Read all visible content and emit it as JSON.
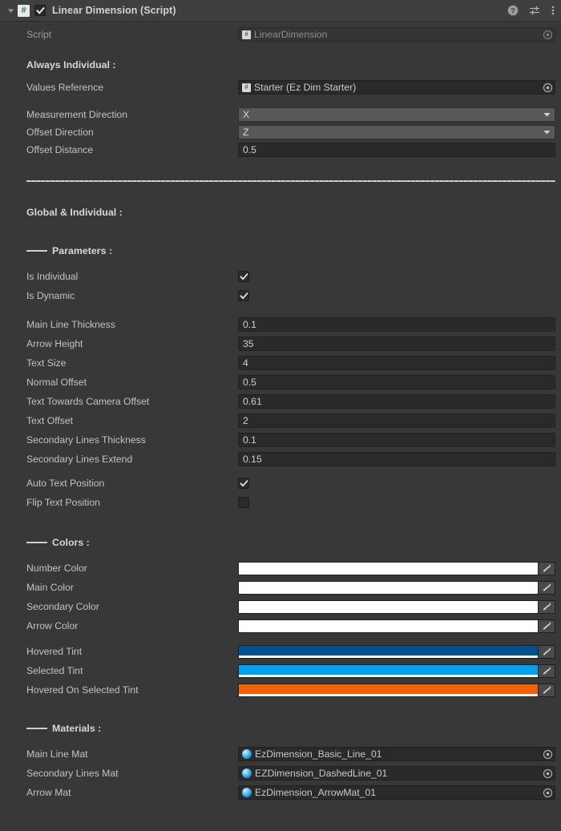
{
  "header": {
    "title": "Linear Dimension (Script)",
    "enabled_checkbox": true,
    "foldout_expanded": true,
    "script_glyph": "#",
    "icons": {
      "foldout": "triangle-down-icon",
      "script": "csharp-script-icon",
      "enabled": "enabled-checkbox",
      "help": "help-icon",
      "preset": "preset-settings-icon",
      "menu": "more-vertical-icon"
    }
  },
  "script_row": {
    "label": "Script",
    "value": "LinearDimension"
  },
  "sections": {
    "always_individual": "Always Individual :",
    "global_individual": "Global & Individual :",
    "parameters": "Parameters :",
    "colors": "Colors :",
    "materials": "Materials :"
  },
  "always_individual": {
    "values_reference": {
      "label": "Values Reference",
      "value": "Starter (Ez Dim Starter)"
    },
    "measurement_direction": {
      "label": "Measurement Direction",
      "value": "X"
    },
    "offset_direction": {
      "label": "Offset Direction",
      "value": "Z"
    },
    "offset_distance": {
      "label": "Offset Distance",
      "value": "0.5"
    }
  },
  "parameters": {
    "toggles_top": [
      {
        "label": "Is Individual",
        "checked": true
      },
      {
        "label": "Is Dynamic",
        "checked": true
      }
    ],
    "numbers": [
      {
        "label": "Main Line Thickness",
        "value": "0.1"
      },
      {
        "label": "Arrow Height",
        "value": "35"
      },
      {
        "label": "Text Size",
        "value": "4"
      },
      {
        "label": "Normal Offset",
        "value": "0.5"
      },
      {
        "label": "Text Towards Camera Offset",
        "value": "0.61"
      },
      {
        "label": "Text Offset",
        "value": "2"
      },
      {
        "label": "Secondary Lines Thickness",
        "value": "0.1"
      },
      {
        "label": "Secondary Lines Extend",
        "value": "0.15"
      }
    ],
    "toggles_bottom": [
      {
        "label": "Auto Text Position",
        "checked": true
      },
      {
        "label": "Flip Text Position",
        "checked": false
      }
    ]
  },
  "colors": [
    {
      "label": "Number Color",
      "hex": "#ffffff",
      "alpha_bar": false
    },
    {
      "label": "Main Color",
      "hex": "#ffffff",
      "alpha_bar": false
    },
    {
      "label": "Secondary Color",
      "hex": "#ffffff",
      "alpha_bar": false
    },
    {
      "label": "Arrow Color",
      "hex": "#ffffff",
      "alpha_bar": false
    },
    {
      "label": "Hovered Tint",
      "hex": "#00528e",
      "alpha_bar": true
    },
    {
      "label": "Selected Tint",
      "hex": "#00a2f0",
      "alpha_bar": true
    },
    {
      "label": "Hovered On Selected Tint",
      "hex": "#f36209",
      "alpha_bar": true
    }
  ],
  "materials": [
    {
      "label": "Main Line Mat",
      "value": "EzDimension_Basic_Line_01"
    },
    {
      "label": "Secondary Lines Mat",
      "value": "EZDimension_DashedLine_01"
    },
    {
      "label": "Arrow Mat",
      "value": "EzDimension_ArrowMat_01"
    }
  ],
  "theme": {
    "background": "#383838",
    "header_bg": "#3f3f3f",
    "field_bg": "#2a2a2a",
    "dropdown_bg": "#585858",
    "label_color": "#c2c2c2",
    "script_icon_green": "#2a7a3e"
  }
}
